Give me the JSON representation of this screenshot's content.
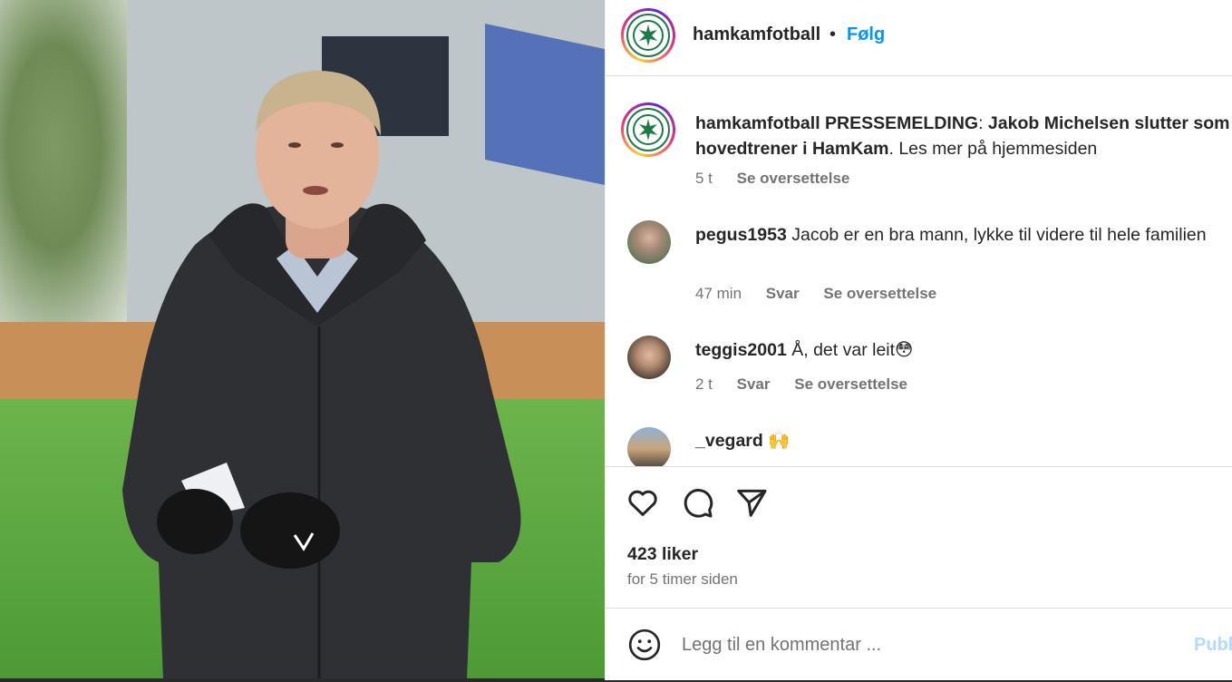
{
  "post": {
    "account": "hamkamfotball",
    "follow_label": "Følg",
    "separator": "•"
  },
  "caption": {
    "username": "hamkamfotball",
    "bold_text": "PRESSEMELDING",
    "colon": ":",
    "bold_text_2": "Jakob Michelsen slutter som hovedtrener i HamKam",
    "rest_text": ". Les mer på hjemmesiden",
    "time": "5 t",
    "translate_label": "Se oversettelse"
  },
  "comments": [
    {
      "username": "pegus1953",
      "text": "Jacob er en bra mann, lykke til videre til hele familien",
      "time": "47 min",
      "reply_label": "Svar",
      "translate_label": "Se oversettelse"
    },
    {
      "username": "teggis2001",
      "text": "Å, det var leit😳",
      "time": "2 t",
      "reply_label": "Svar",
      "translate_label": "Se oversettelse"
    },
    {
      "username": "_vegard",
      "text": "🙌"
    }
  ],
  "engagement": {
    "likes": "423 liker",
    "posted": "for 5 timer siden"
  },
  "composer": {
    "placeholder": "Legg til en kommentar ...",
    "publish_label": "Publ"
  },
  "colors": {
    "link_blue": "#0095f6",
    "muted_text": "#737373",
    "publish_disabled": "#b3dbff"
  }
}
